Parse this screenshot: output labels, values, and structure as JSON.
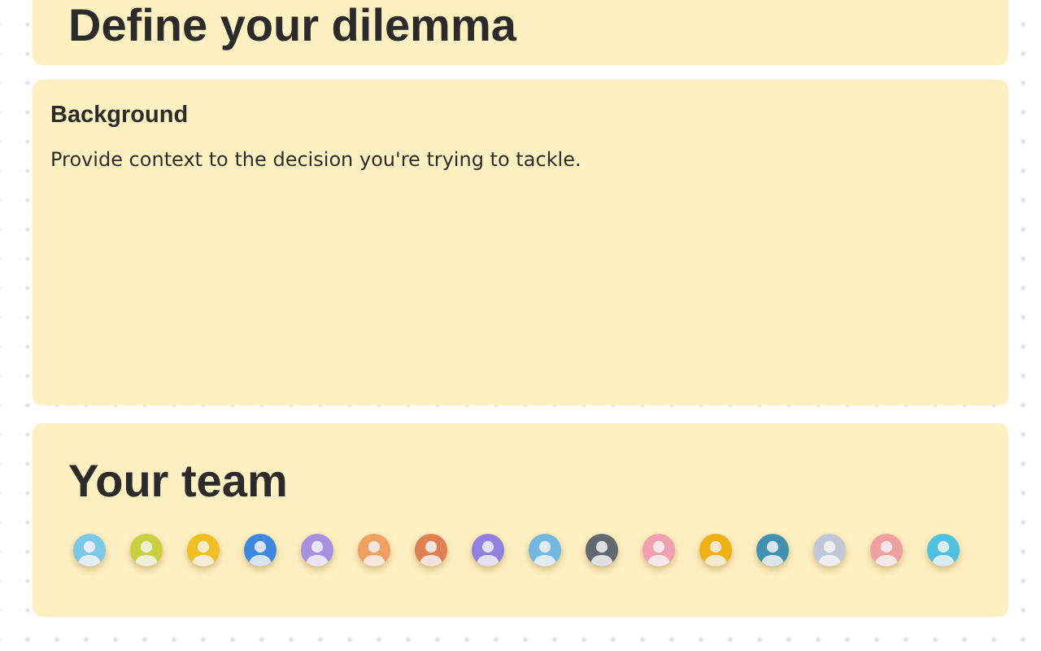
{
  "dilemma": {
    "title": "Define your dilemma"
  },
  "background": {
    "heading": "Background",
    "prompt": "Provide context to the decision you're trying to tackle."
  },
  "team": {
    "title": "Your team",
    "members": [
      {
        "color": "#7cc8e8"
      },
      {
        "color": "#c8d040"
      },
      {
        "color": "#f0c020"
      },
      {
        "color": "#3a88e0"
      },
      {
        "color": "#a890e0"
      },
      {
        "color": "#f0a060"
      },
      {
        "color": "#e08050"
      },
      {
        "color": "#9080e0"
      },
      {
        "color": "#70b8e0"
      },
      {
        "color": "#606870"
      },
      {
        "color": "#f0a0b0"
      },
      {
        "color": "#f0b010"
      },
      {
        "color": "#4090b0"
      },
      {
        "color": "#c0c8d8"
      },
      {
        "color": "#f0a0a0"
      },
      {
        "color": "#50c0e0"
      }
    ]
  }
}
